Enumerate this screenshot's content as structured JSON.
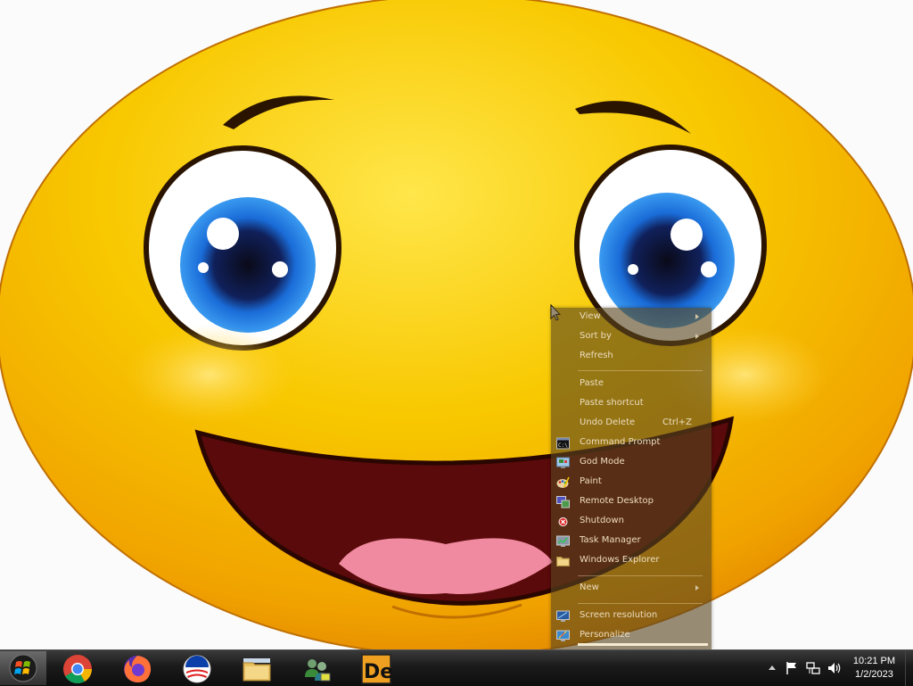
{
  "context_menu": {
    "items": [
      {
        "label": "View",
        "submenu": true
      },
      {
        "label": "Sort by",
        "submenu": true
      },
      {
        "label": "Refresh"
      },
      {
        "label": "Paste"
      },
      {
        "label": "Paste shortcut"
      },
      {
        "label": "Undo Delete",
        "shortcut": "Ctrl+Z"
      },
      {
        "label": "Command Prompt",
        "icon": "command-prompt-icon"
      },
      {
        "label": "God Mode",
        "icon": "control-panel-icon"
      },
      {
        "label": "Paint",
        "icon": "paint-palette-icon"
      },
      {
        "label": "Remote Desktop",
        "icon": "remote-desktop-icon"
      },
      {
        "label": "Shutdown",
        "icon": "shutdown-icon"
      },
      {
        "label": "Task Manager",
        "icon": "task-manager-icon"
      },
      {
        "label": "Windows Explorer",
        "icon": "folder-icon"
      },
      {
        "label": "New",
        "submenu": true
      },
      {
        "label": "Screen resolution",
        "icon": "screen-resolution-icon"
      },
      {
        "label": "Personalize",
        "icon": "personalize-icon"
      }
    ]
  },
  "taskbar": {
    "apps": [
      {
        "name": "start-button",
        "icon": "windows-start-orb-icon"
      },
      {
        "name": "chrome",
        "icon": "chrome-icon"
      },
      {
        "name": "firefox",
        "icon": "firefox-icon"
      },
      {
        "name": "obama-campaign",
        "icon": "obama-logo-icon"
      },
      {
        "name": "file-explorer",
        "icon": "folder-icon"
      },
      {
        "name": "network-users",
        "icon": "network-users-icon"
      },
      {
        "name": "de-app",
        "icon": "de-app-icon",
        "label": "De"
      }
    ],
    "tray": {
      "icons": [
        "show-hidden-icons-arrow",
        "action-center-flag-icon",
        "network-icon",
        "volume-icon"
      ],
      "time": "10:21 PM",
      "date": "1/2/2023"
    }
  },
  "colors": {
    "menu_bg": "#5a4820",
    "menu_text": "#ecdcc0",
    "taskbar_bg": "#1a1a1a",
    "face_yellow": "#f5c000",
    "iris_blue": "#1a6cd8"
  }
}
